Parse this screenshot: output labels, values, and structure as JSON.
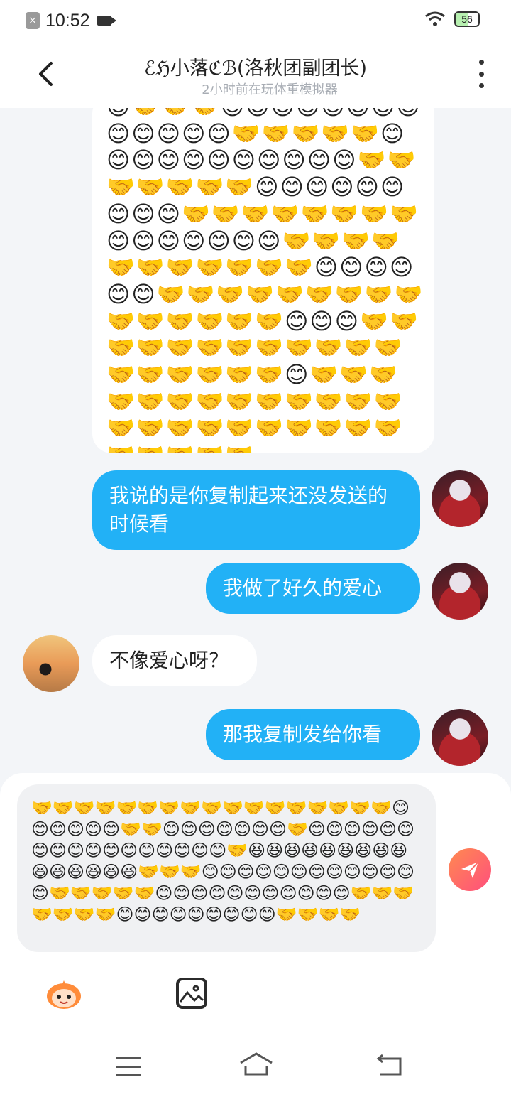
{
  "status_bar": {
    "time": "10:52",
    "battery": "56"
  },
  "header": {
    "title": "ℰℌ小落ℭℬ(洛秋团副团长)",
    "subtitle": "2小时前在玩体重模拟器"
  },
  "messages": [
    {
      "id": "emoji-block",
      "side": "in",
      "text": "😊🤝🤝🤝😊😊😊😊😊😊😊😊😊😊😊😊😊🤝🤝🤝🤝🤝😊😊😊😊😊😊😊😊😊😊😊🤝🤝🤝🤝🤝🤝🤝😊😊😊😊😊😊😊😊😊🤝🤝🤝🤝🤝🤝🤝🤝😊😊😊😊😊😊😊🤝🤝🤝🤝🤝🤝🤝🤝🤝🤝🤝😊😊😊😊😊😊🤝🤝🤝🤝🤝🤝🤝🤝🤝🤝🤝🤝🤝🤝🤝😊😊😊🤝🤝🤝🤝🤝🤝🤝🤝🤝🤝🤝🤝🤝🤝🤝🤝🤝🤝😊🤝🤝🤝🤝🤝🤝🤝🤝🤝🤝🤝🤝🤝🤝🤝🤝🤝🤝🤝🤝🤝🤝🤝🤝🤝🤝🤝🤝"
    },
    {
      "id": "m1",
      "side": "out",
      "text": "我说的是你复制起来还没发送的时候看"
    },
    {
      "id": "m2",
      "side": "out",
      "text": "我做了好久的爱心"
    },
    {
      "id": "m3",
      "side": "in",
      "text": "不像爱心呀？"
    },
    {
      "id": "m4",
      "side": "out",
      "text": "那我复制发给你看"
    }
  ],
  "composer": {
    "input_value": "🤝🤝🤝🤝🤝🤝🤝🤝🤝🤝🤝🤝🤝🤝🤝🤝🤝😊😊😊😊😊😊🤝🤝😊😊😊😊😊😊😊🤝😊😊😊😊😊😊😊😊😊😊😊😊😊😊😊😊😊🤝😆😆😆😆😆😆😆😆😆😆😆😆😆😆😆🤝🤝🤝😊😊😊😊😊😊😊😊😊😊😊😊😊🤝🤝🤝🤝🤝😊😊😊😊😊😊😊😊😊😊😊🤝🤝🤝🤝🤝🤝🤝😊😊😊😊😊😊😊😊😊🤝🤝🤝🤝"
  },
  "icons": {
    "back": "chevron-left-icon",
    "more": "more-vertical-icon",
    "send": "paper-plane-icon",
    "mascot": "mascot-emoji-icon",
    "image": "image-icon"
  },
  "colors": {
    "accent": "#22b1f6",
    "send_gradient_start": "#ff8a50",
    "send_gradient_end": "#ff4f7d"
  }
}
